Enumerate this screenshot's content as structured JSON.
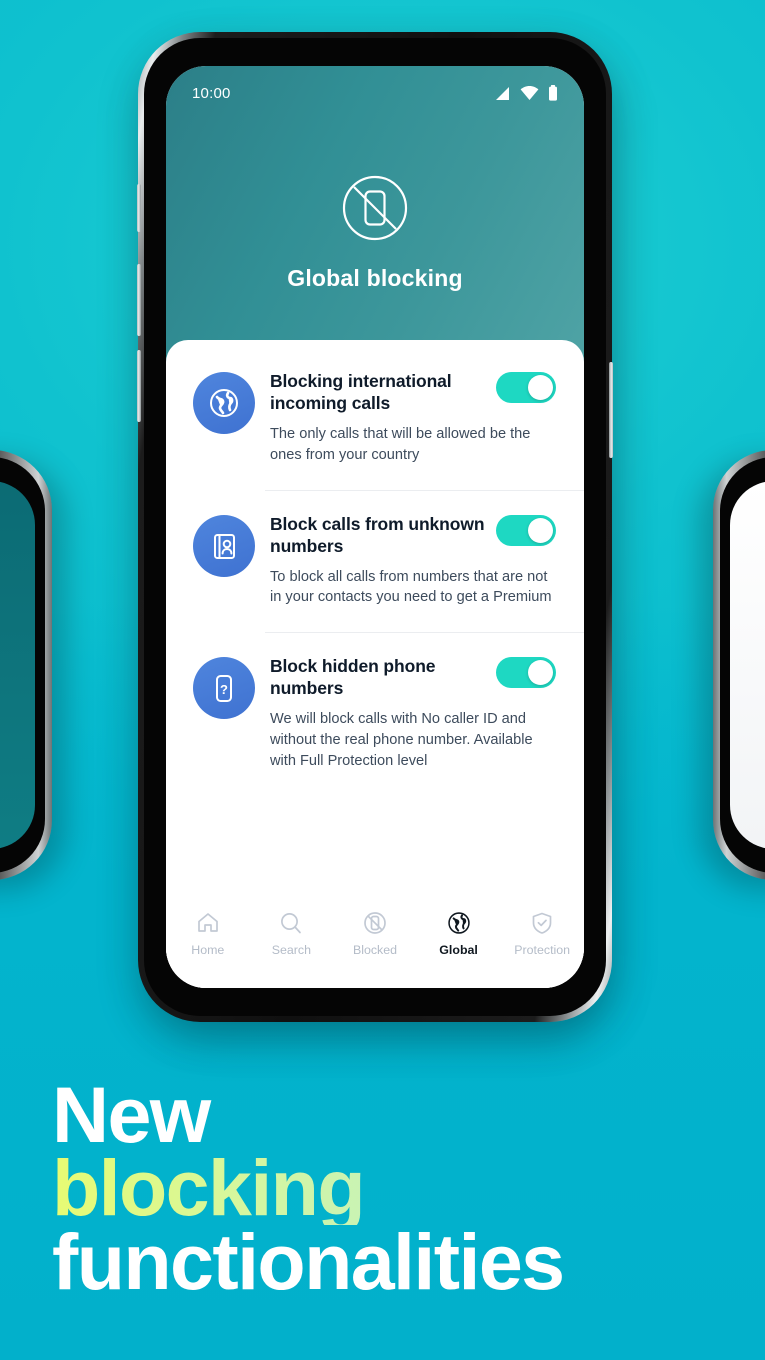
{
  "theme": {
    "background_teal": "#0cbcd0",
    "header_teal": "#2c7f88",
    "toggle_on": "#1ed8c2",
    "icon_blue": "#4178d6",
    "accent_lime": "#e8fb72"
  },
  "phone": {
    "status_bar": {
      "time": "10:00",
      "icons": [
        "signal-icon",
        "wifi-icon",
        "battery-icon"
      ]
    },
    "header": {
      "icon": "no-phone-icon",
      "title": "Global blocking"
    },
    "settings": [
      {
        "icon": "globe-icon",
        "title": "Blocking international incoming calls",
        "description": "The only calls that will be allowed be the ones from your country",
        "toggle_state": "on"
      },
      {
        "icon": "contacts-book-icon",
        "title": "Block calls from unknown numbers",
        "description": "To block all calls from numbers that are not in your contacts you need to get a Premium",
        "toggle_state": "on"
      },
      {
        "icon": "phone-question-icon",
        "title": "Block hidden phone numbers",
        "description": "We will block calls with No caller ID and without the real phone number. Available with Full Protection level",
        "toggle_state": "on"
      }
    ],
    "bottom_nav": [
      {
        "icon": "home-icon",
        "label": "Home",
        "active": false
      },
      {
        "icon": "search-icon",
        "label": "Search",
        "active": false
      },
      {
        "icon": "blocked-icon",
        "label": "Blocked",
        "active": false
      },
      {
        "icon": "globe-icon",
        "label": "Global",
        "active": true
      },
      {
        "icon": "shield-check-icon",
        "label": "Protection",
        "active": false
      }
    ]
  },
  "marketing": {
    "line1": "New",
    "line2": "blocking",
    "line3": "functionalities"
  }
}
